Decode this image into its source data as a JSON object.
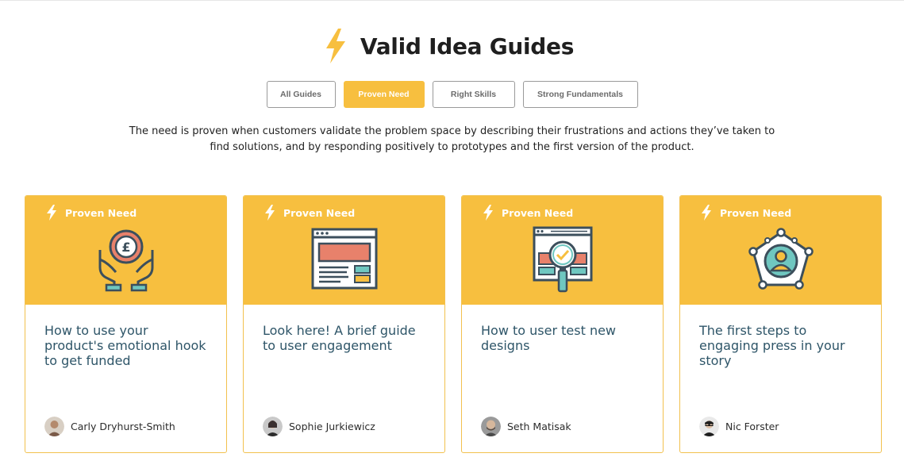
{
  "header": {
    "title": "Valid Idea Guides",
    "icon": "lightning-bolt-icon",
    "accent": "#f7bf3f"
  },
  "filters": [
    {
      "label": "All Guides",
      "active": false
    },
    {
      "label": "Proven Need",
      "active": true
    },
    {
      "label": "Right Skills",
      "active": false
    },
    {
      "label": "Strong Fundamentals",
      "active": false
    }
  ],
  "description": "The need is proven when customers validate the problem space by describing their frustrations and actions they’ve taken to find solutions, and by responding positively to prototypes and the first version of the product.",
  "cards": [
    {
      "badge": "Proven Need",
      "illustration": "hands-pound-coin-icon",
      "title": "How to use your product's emotional hook to get funded",
      "author": "Carly Dryhurst-Smith"
    },
    {
      "badge": "Proven Need",
      "illustration": "browser-window-icon",
      "title": "Look here! A brief guide to user engagement",
      "author": "Sophie Jurkiewicz"
    },
    {
      "badge": "Proven Need",
      "illustration": "magnifier-checkmark-icon",
      "title": "How to user test new designs",
      "author": "Seth Matisak"
    },
    {
      "badge": "Proven Need",
      "illustration": "user-network-icon",
      "title": "The first steps to engaging press in your story",
      "author": "Nic Forster"
    }
  ]
}
